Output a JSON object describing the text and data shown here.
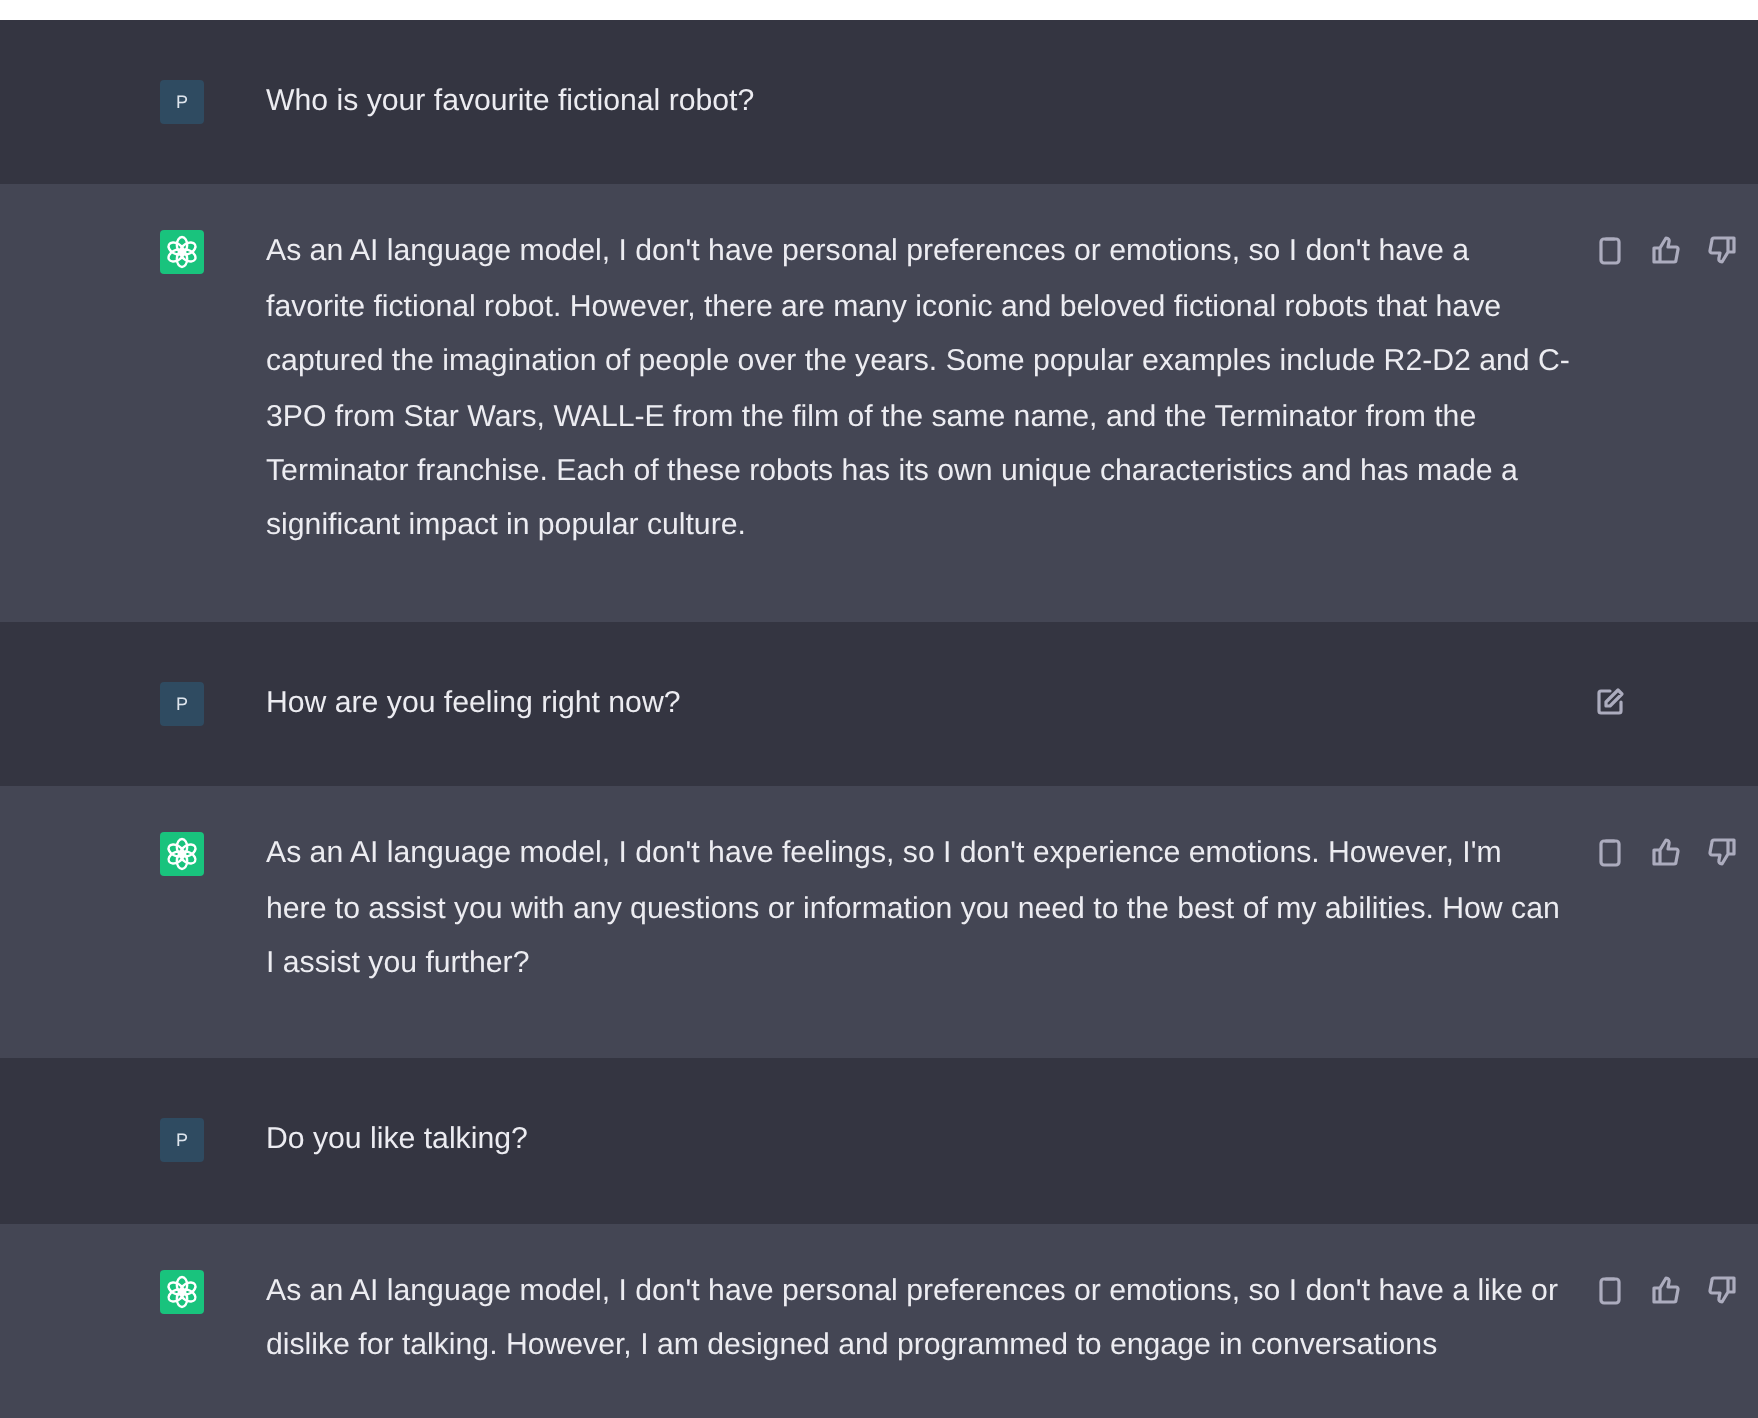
{
  "messages": [
    {
      "kind": "user",
      "avatar": "P",
      "text": "Who is your favourite fictional robot?",
      "editable": false
    },
    {
      "kind": "assistant",
      "text": "As an AI language model, I don't have personal preferences or emotions, so I don't have a favorite fictional robot. However, there are many iconic and beloved fictional robots that have captured the imagination of people over the years. Some popular examples include R2-D2 and C-3PO from Star Wars, WALL-E from the film of the same name, and the Terminator from the Terminator franchise. Each of these robots has its own unique characteristics and has made a significant impact in popular culture."
    },
    {
      "kind": "user",
      "avatar": "P",
      "text": "How are you feeling right now?",
      "editable": true
    },
    {
      "kind": "assistant",
      "text": "As an AI language model, I don't have feelings, so I don't experience emotions. However, I'm here to assist you with any questions or information you need to the best of my abilities. How can I assist you further?"
    },
    {
      "kind": "user",
      "avatar": "P",
      "text": "Do you like talking?",
      "editable": false
    },
    {
      "kind": "assistant",
      "text": "As an AI language model, I don't have personal preferences or emotions, so I don't have a like or dislike for talking. However, I am designed and programmed to engage in conversations"
    }
  ]
}
